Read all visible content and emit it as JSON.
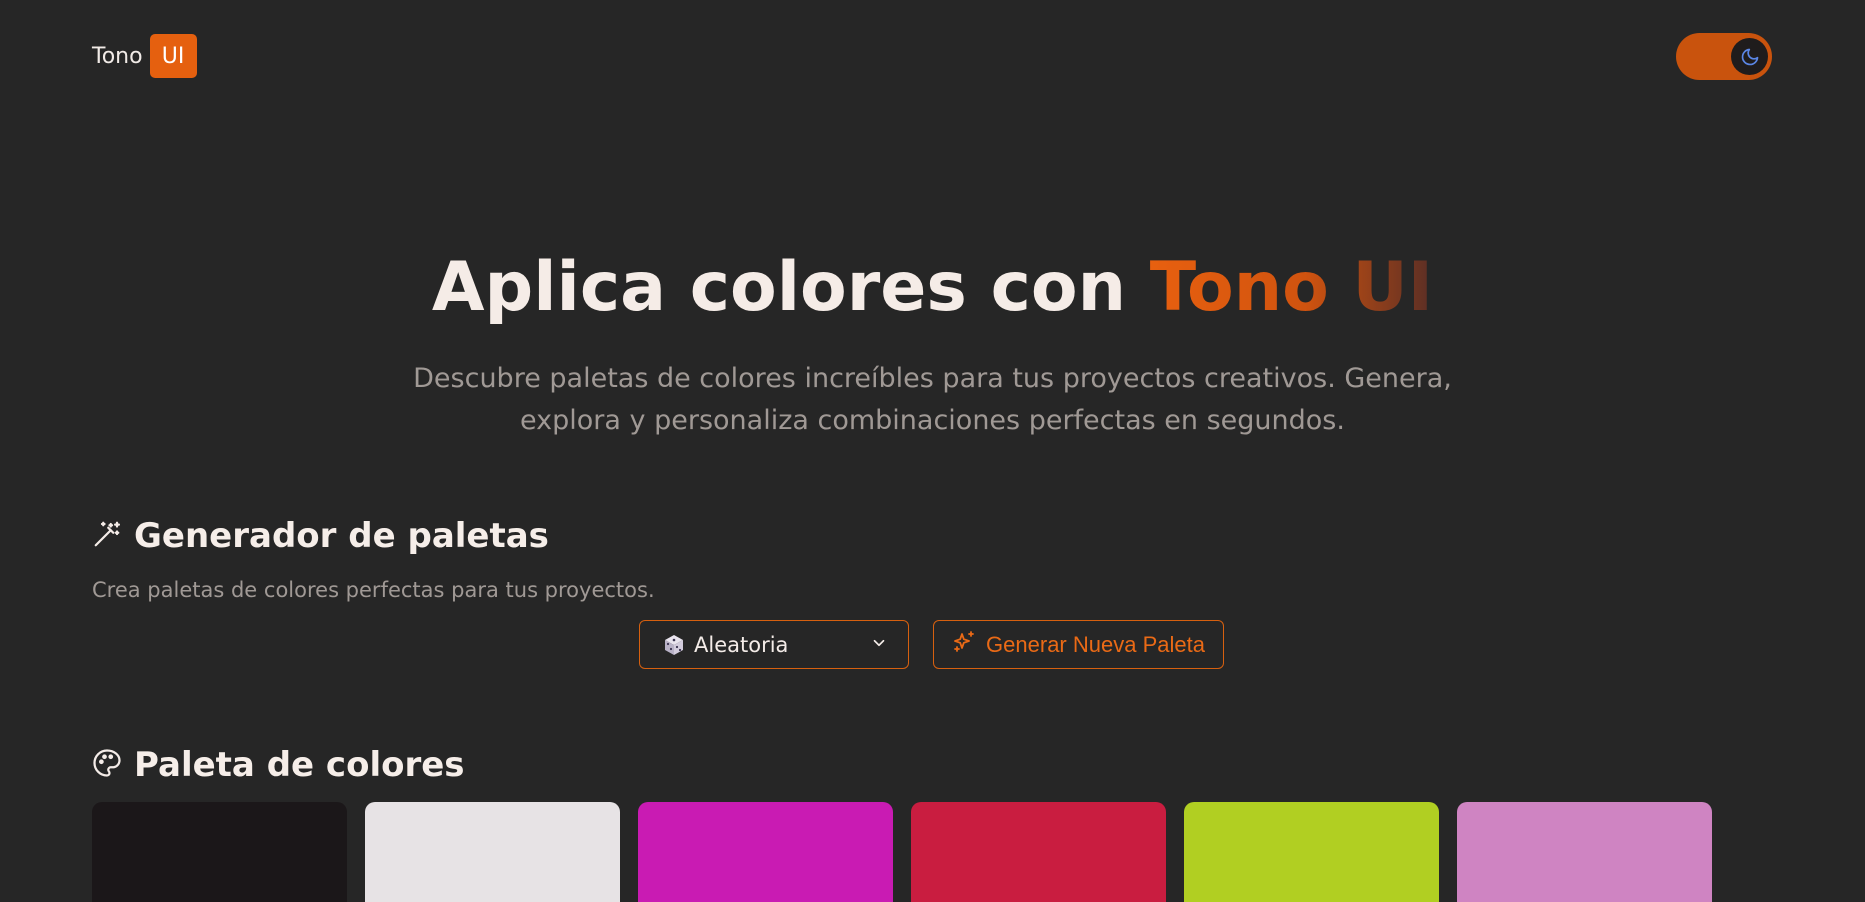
{
  "header": {
    "logo_text": "Tono",
    "logo_badge": "UI",
    "theme_toggle_icon": "moon-icon",
    "accent": "#e5600f"
  },
  "hero": {
    "title_prefix": "Aplica colores con",
    "title_accent": "Tono UI",
    "subtitle": "Descubre paletas de colores increíbles para tus proyectos creativos. Genera, explora y personaliza combinaciones perfectas en segundos."
  },
  "generator": {
    "icon": "magic-wand-icon",
    "title": "Generador de paletas",
    "description": "Crea paletas de colores perfectas para tus proyectos.",
    "mode_select": {
      "icon": "dice-icon",
      "value": "Aleatoria"
    },
    "generate_button": {
      "icon": "sparkles-icon",
      "label": "Generar Nueva Paleta"
    }
  },
  "palette": {
    "icon": "palette-icon",
    "title": "Paleta de colores",
    "colors": [
      "#1b1719",
      "#e7e3e5",
      "#c91bb3",
      "#c91d40",
      "#b1cf22",
      "#cf84c2"
    ]
  }
}
